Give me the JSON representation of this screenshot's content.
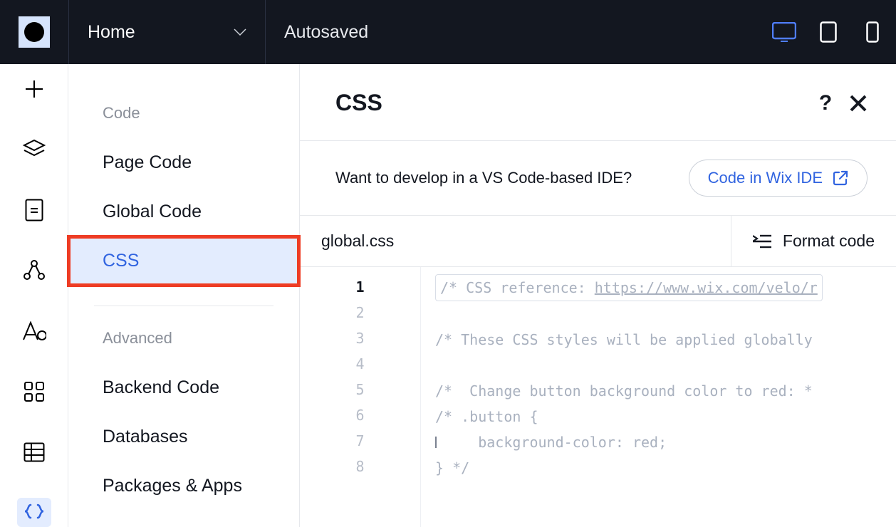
{
  "topbar": {
    "page_label": "Home",
    "autosaved_label": "Autosaved"
  },
  "sidebar": {
    "section1_heading": "Code",
    "page_code": "Page Code",
    "global_code": "Global Code",
    "css": "CSS",
    "section2_heading": "Advanced",
    "backend_code": "Backend Code",
    "databases": "Databases",
    "packages": "Packages & Apps"
  },
  "content": {
    "title": "CSS",
    "ide_prompt": "Want to develop in a VS Code-based IDE?",
    "ide_button": "Code in Wix IDE",
    "file_name": "global.css",
    "format_button": "Format code"
  },
  "editor": {
    "line_numbers": [
      "1",
      "2",
      "3",
      "4",
      "5",
      "6",
      "7",
      "8"
    ],
    "active_line": 1,
    "line1_prefix": "/* CSS reference: ",
    "line1_url": "https://www.wix.com/velo/r",
    "line3": "/* These CSS styles will be applied globally",
    "line5": "/*  Change button background color to red: *",
    "line6": "/* .button {",
    "line7": "     background-color: red;",
    "line8": "} */"
  }
}
